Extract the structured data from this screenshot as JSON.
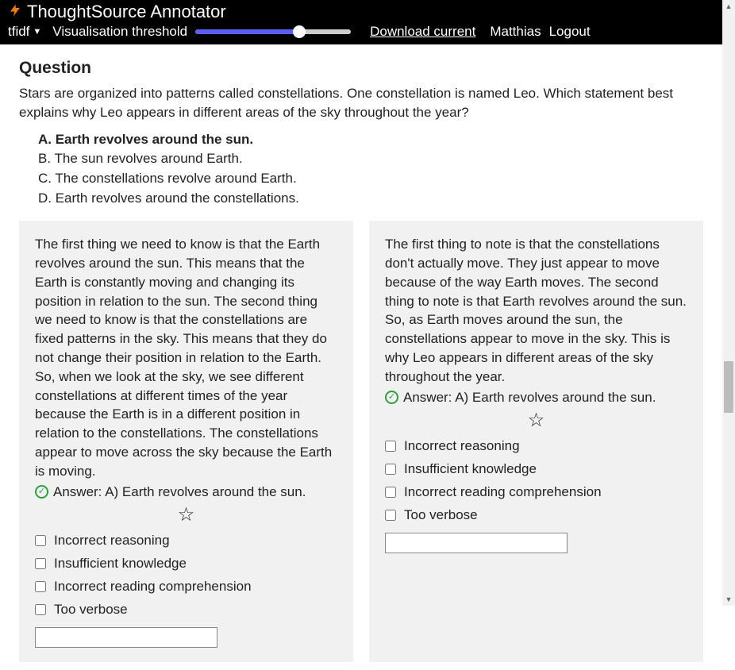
{
  "topbar": {
    "app_title": "ThoughtSource Annotator",
    "dropdown_label": "tfidf",
    "slider_label": "Visualisation threshold",
    "download_link": "Download current",
    "user_name": "Matthias",
    "logout_label": "Logout"
  },
  "section": {
    "title": "Question",
    "question_text": "Stars are organized into patterns called constellations. One constellation is named Leo. Which statement best explains why Leo appears in different areas of the sky throughout the year?",
    "options": {
      "a": "A. Earth revolves around the sun.",
      "b": "B. The sun revolves around Earth.",
      "c": "C. The constellations revolve around Earth.",
      "d": "D. Earth revolves around the constellations."
    }
  },
  "cards": [
    {
      "body": "The first thing we need to know is that the Earth revolves around the sun. This means that the Earth is constantly moving and changing its position in relation to the sun. The second thing we need to know is that the constellations are fixed patterns in the sky. This means that they do not change their position in relation to the Earth. So, when we look at the sky, we see different constellations at different times of the year because the Earth is in a different position in relation to the constellations. The constellations appear to move across the sky because the Earth is moving.",
      "answer": "Answer: A) Earth revolves around the sun."
    },
    {
      "body": "The first thing to note is that the constellations don't actually move. They just appear to move because of the way Earth moves. The second thing to note is that Earth revolves around the sun. So, as Earth moves around the sun, the constellations appear to move in the sky. This is why Leo appears in different areas of the sky throughout the year.",
      "answer": "Answer: A) Earth revolves around the sun."
    }
  ],
  "checks": {
    "incorrect_reasoning": "Incorrect reasoning",
    "insufficient_knowledge": "Insufficient knowledge",
    "incorrect_reading": "Incorrect reading comprehension",
    "too_verbose": "Too verbose"
  }
}
